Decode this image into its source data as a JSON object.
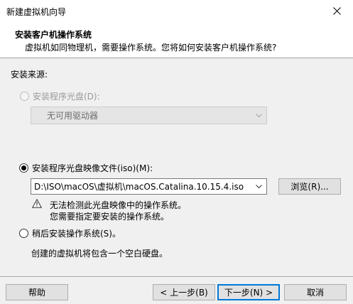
{
  "window": {
    "title": "新建虚拟机向导"
  },
  "header": {
    "title": "安装客户机操作系统",
    "subtitle": "虚拟机如同物理机，需要操作系统。您将如何安装客户机操作系统?"
  },
  "source_label": "安装来源:",
  "options": {
    "disc": {
      "label": "安装程序光盘(D):",
      "selected": false,
      "enabled": false,
      "drive_value": "无可用驱动器"
    },
    "iso": {
      "label": "安装程序光盘映像文件(iso)(M):",
      "selected": true,
      "path_value": "D:\\ISO\\macOS\\虚拟机\\macOS.Catalina.10.15.4.iso",
      "browse_label": "浏览(R)..."
    },
    "later": {
      "label": "稍后安装操作系统(S)。",
      "selected": false,
      "description": "创建的虚拟机将包含一个空白硬盘。"
    }
  },
  "warning": {
    "line1": "无法检测此光盘映像中的操作系统。",
    "line2": "您需要指定要安装的操作系统。"
  },
  "footer": {
    "help": "帮助",
    "back": "< 上一步(B)",
    "next": "下一步(N) >",
    "cancel": "取消"
  }
}
